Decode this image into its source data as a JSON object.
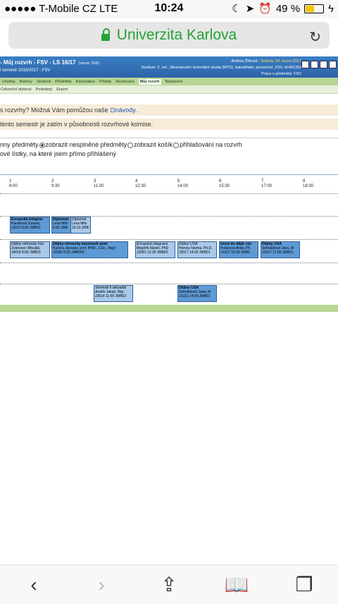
{
  "status": {
    "carrier": "●●●●● T-Mobile CZ  LTE",
    "time": "10:24",
    "battery": "49 %",
    "battery_level": 0.49
  },
  "browser": {
    "url": "Univerzita Karlova"
  },
  "sis": {
    "title": "- Můj rozvrh - FSV - LS 16/17",
    "version": "(verze: 916)",
    "subtitle": "l semestr 2016/2017 - FSV",
    "user": "Andrea Žítková",
    "date": "Sobota, 04. února 2017",
    "study": "Studium: 2. roč., Mezinárodní teritoriální studia (MTS), bakalářské, prezenční, FSV, id:481353",
    "work": "Práce s předměty: FSV",
    "menu": [
      "Učebny",
      "Budovy",
      "Studenti",
      "Předměty",
      "Konzultace",
      "Předdy",
      "Rezervace",
      "Můj rozvrh",
      "Nastavení"
    ],
    "submenu": [
      "Celoroční blokový",
      "Podrobný",
      "Export"
    ],
    "help_text": "s rozvrhy? Možná Vám pomůžou naše",
    "help_link": "návody",
    "help_dot": ".",
    "committee": "tento semestr je zatím v působnosti rozvrhové komise.",
    "filter_line1_a": "nny předměty",
    "filter_line1_b": "zobrazit nesplněné předměty",
    "filter_line1_c": "zobrazit košík",
    "filter_line1_d": "přihlašování na rozvrh",
    "filter_line2": "ové lístky, na které jsem přímo přihlášený",
    "ticks": [
      {
        "n": "1",
        "t": "8:00"
      },
      {
        "n": "2",
        "t": "9:30"
      },
      {
        "n": "3",
        "t": "11:00"
      },
      {
        "n": "4",
        "t": "12:30"
      },
      {
        "n": "5",
        "t": "14:00"
      },
      {
        "n": "6",
        "t": "15:30"
      },
      {
        "n": "7",
        "t": "17:00"
      },
      {
        "n": "8",
        "t": "18:30"
      }
    ],
    "blocks": [
      {
        "title": "Evropská integrac",
        "line2": "Kasáková Zuzana,",
        "line3": "J3015 8:00 JMB02"
      },
      {
        "title": "Diplomat",
        "line2": "Lexa Milo",
        "line3": "9:30 JMB"
      },
      {
        "title": "Diplomat",
        "line2": "Lexa Milo",
        "line3": "10:10 JMB"
      },
      {
        "title": "Dějiny německy mlu",
        "line2": "Zvánovec Mikuláš,",
        "line3": "J4018 8:00 JMB03"
      },
      {
        "title": "Dějiny německy mluvících zemí",
        "line2": "Kučera Jaroslav, prof. PhDr., CSc., Nigri",
        "line3": "J2080 9:30 JMB009"
      },
      {
        "title": "Evropská integrace",
        "line2": "Mejstřík Martin, PhD",
        "line3": "J2081 12:30 JMB02"
      },
      {
        "title": "Dějiny USA",
        "line2": "Hervey Norma, Ph.D.",
        "line3": "J3017 14:00 JMB01"
      },
      {
        "title": "Úvod do dějin výc",
        "line2": "Pelánová Anita, Ph.",
        "line3": "J1037 15:30 JMB0"
      },
      {
        "title": "Dějiny USA",
        "line2": "Sehnálková Jana, M",
        "line3": "J1037 17:00 JMB01"
      },
      {
        "title": "Seminář k aktualitá",
        "line2": "Andrle Jakub, Mgr.",
        "line3": "J3014 11:00 JMB02"
      },
      {
        "title": "Dějiny USA",
        "line2": "Sehnálková Jana, M",
        "line3": "J1031 14:00 JMB01"
      }
    ]
  }
}
